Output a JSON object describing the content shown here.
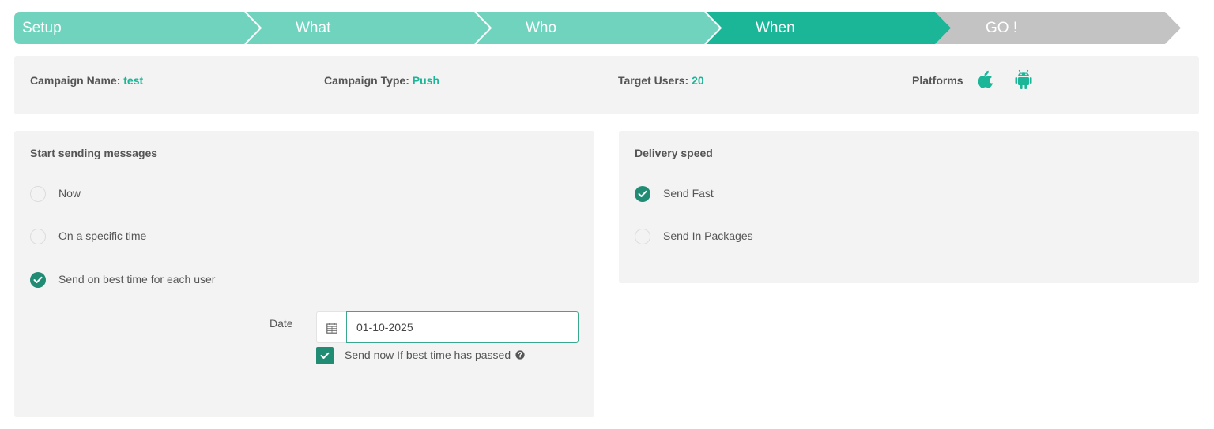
{
  "steps": [
    {
      "label": "Setup"
    },
    {
      "label": "What"
    },
    {
      "label": "Who"
    },
    {
      "label": "When"
    },
    {
      "label": "GO !"
    }
  ],
  "active_step": "When",
  "summary": {
    "campaign_name_label": "Campaign Name:",
    "campaign_name_value": "test",
    "campaign_type_label": "Campaign Type:",
    "campaign_type_value": "Push",
    "target_users_label": "Target Users:",
    "target_users_value": "20",
    "platforms_label": "Platforms",
    "platform_icons": [
      "apple-icon",
      "android-icon"
    ]
  },
  "start_sending": {
    "title": "Start sending messages",
    "options": [
      {
        "label": "Now",
        "checked": false
      },
      {
        "label": "On a specific time",
        "checked": false
      },
      {
        "label": "Send on best time for each user",
        "checked": true
      }
    ],
    "date_label": "Date",
    "date_value": "01-10-2025",
    "send_now_label": "Send now If best time has passed",
    "send_now_checked": true
  },
  "delivery_speed": {
    "title": "Delivery speed",
    "options": [
      {
        "label": "Send Fast",
        "checked": true
      },
      {
        "label": "Send In Packages",
        "checked": false
      }
    ]
  },
  "colors": {
    "step_done": "#70d3be",
    "step_active": "#1bb597",
    "step_pending": "#c3c3c3",
    "accent_text": "#1bb597",
    "check_fill": "#1f8c73",
    "panel_bg": "#f3f3f3"
  }
}
